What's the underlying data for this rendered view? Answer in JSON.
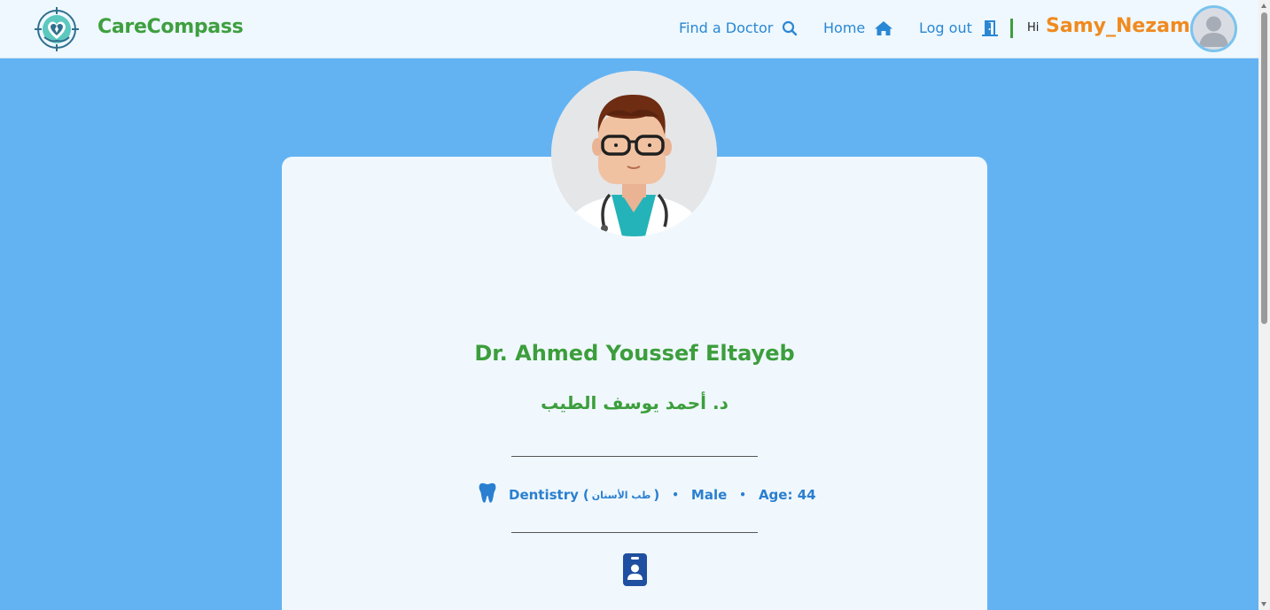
{
  "app": {
    "brand": "CareCompass"
  },
  "nav": {
    "find_doctor": "Find a Doctor",
    "home": "Home",
    "logout": "Log out",
    "greeting": "Hi",
    "username": "Samy_Nezam"
  },
  "doctor": {
    "name_en": "Dr. Ahmed Youssef Eltayeb",
    "name_ar": "د. أحمد يوسف الطيب",
    "specialty": "Dentistry",
    "specialty_ar": "طب الأسنان",
    "paren_open": "(",
    "paren_close": ")",
    "gender": "Male",
    "age": "Age: 44",
    "bullet": "•"
  },
  "icons": {
    "logo": "compass-heart-logo",
    "find": "search-icon",
    "home": "home-icon",
    "logout": "door-exit-icon",
    "specialty": "tooth-icon",
    "contact": "id-badge-icon"
  },
  "colors": {
    "brand_green": "#3f9f3f",
    "link_blue": "#2a87d4",
    "username_orange": "#f08a1f",
    "page_background": "#63b3f3",
    "card_background": "#f0f8fe"
  }
}
